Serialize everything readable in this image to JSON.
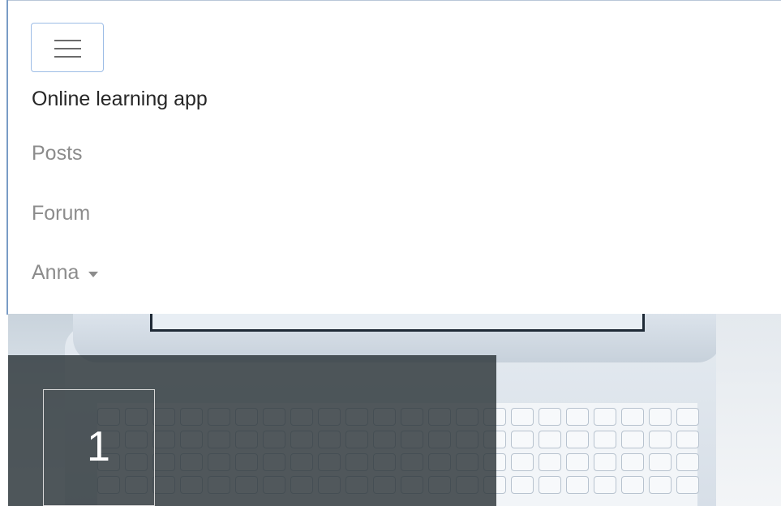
{
  "navbar": {
    "toggle_icon": "hamburger-menu-icon",
    "brand": "Online learning app",
    "links": [
      {
        "label": "Posts"
      },
      {
        "label": "Forum"
      }
    ],
    "user_menu": {
      "label": "Anna",
      "icon": "caret-down-icon"
    }
  },
  "carousel": {
    "slide_number": "1"
  },
  "colors": {
    "toggler_border": "#9dbde6",
    "brand_text": "#262626",
    "link_text": "#8c8c8c",
    "caption_overlay": "#2c3438"
  }
}
